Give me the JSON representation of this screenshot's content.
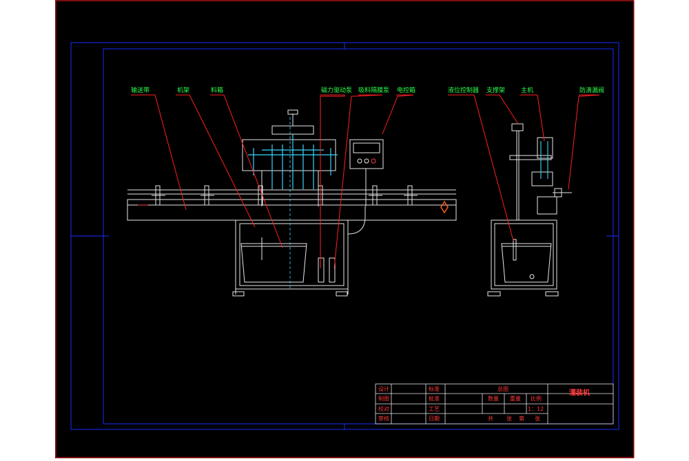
{
  "drawing": {
    "callouts": {
      "conveyor": "输送带",
      "frame": "机架",
      "hopper": "料箱",
      "magnetic_pump": "磁力驱动泵",
      "suction_tube": "吸料隔膜泵",
      "control_box": "电控箱",
      "level_control": "液位控制器",
      "support": "支撑架",
      "main_unit": "主机",
      "anti_drip": "防滴漏阀"
    },
    "title_block": {
      "drawing_name": "灌装机",
      "view_name": "总图",
      "scale": "1：12",
      "left_labels": [
        "设计",
        "制图",
        "校对",
        "审核"
      ],
      "mid_labels": [
        "标准",
        "批准",
        "工艺",
        "日期"
      ],
      "col_headers": [
        "数量",
        "重量",
        "比例"
      ],
      "sheet_info": [
        "共",
        "张",
        "第",
        "张"
      ]
    },
    "colors": {
      "background": "#000000",
      "outer_border": "#d01818",
      "inner_border": "#1a2cff",
      "machine": "#e8e8e8",
      "nozzle": "#3ad6ff",
      "leader": "#ff2020",
      "callout_text": "#2cff4a",
      "title_text": "#ff3a3a"
    }
  }
}
